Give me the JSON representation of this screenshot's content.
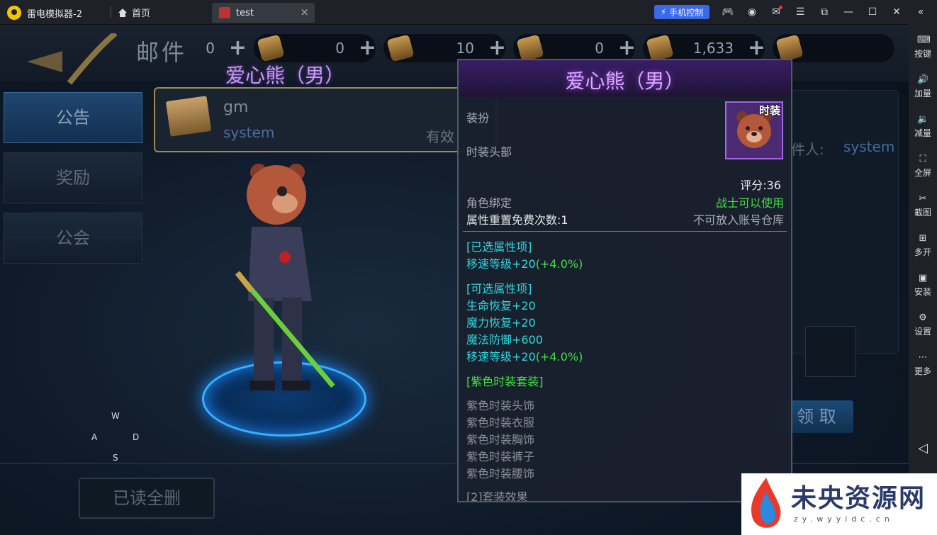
{
  "titlebar": {
    "app_name": "雷电模拟器-2",
    "home_label": "首页",
    "tab_label": "test",
    "tab_close": "×",
    "phone_control": "手机控制"
  },
  "sidebar": {
    "items": [
      {
        "label": "按键",
        "icon": "keyboard-icon"
      },
      {
        "label": "加量",
        "icon": "volume-up-icon"
      },
      {
        "label": "减量",
        "icon": "volume-down-icon"
      },
      {
        "label": "全屏",
        "icon": "fullscreen-icon"
      },
      {
        "label": "截图",
        "icon": "scissors-icon"
      },
      {
        "label": "多开",
        "icon": "multi-instance-icon"
      },
      {
        "label": "安装",
        "icon": "apk-icon"
      },
      {
        "label": "设置",
        "icon": "gear-icon"
      },
      {
        "label": "更多",
        "icon": "more-icon"
      }
    ]
  },
  "game": {
    "page_title": "邮件",
    "resources": [
      "0",
      "0",
      "10",
      "0",
      "1,633"
    ],
    "nav_tabs": [
      "公告",
      "奖励",
      "公会"
    ],
    "mail": {
      "title": "gm",
      "sender": "system",
      "status": "有效"
    },
    "character_name": "爱心熊（男）",
    "receiver_label": "件人:",
    "receiver_value": "system",
    "receive_button": "领 取",
    "delete_all_button": "已读全删",
    "dpad": {
      "up": "W",
      "left": "A",
      "right": "D",
      "down": "S"
    }
  },
  "tooltip": {
    "title": "爱心熊（男）",
    "icon_tag": "时装",
    "category": "装扮",
    "slot": "时装头部",
    "score": "评分:36",
    "bind": "角色绑定",
    "class_req": "战士可以使用",
    "reset": "属性重置免费次数:1",
    "storage": "不可放入账号仓库",
    "selected_header": "[已选属性项]",
    "selected_attr": "移速等级+20",
    "selected_attr_pct": "(+4.0%)",
    "optional_header": "[可选属性项]",
    "optional_attrs": [
      "生命恢复+20",
      "魔力恢复+20",
      "魔法防御+600"
    ],
    "optional_last": "移速等级+20",
    "optional_last_pct": "(+4.0%)",
    "set_header": "[紫色时装套装]",
    "set_items": [
      "紫色时装头饰",
      "紫色时装衣服",
      "紫色时装胸饰",
      "紫色时装裤子",
      "紫色时装腰饰"
    ],
    "set_effect": "[2]套装效果"
  },
  "watermark": {
    "text": "未央资源网",
    "url": "zy.wyyidc.cn"
  }
}
